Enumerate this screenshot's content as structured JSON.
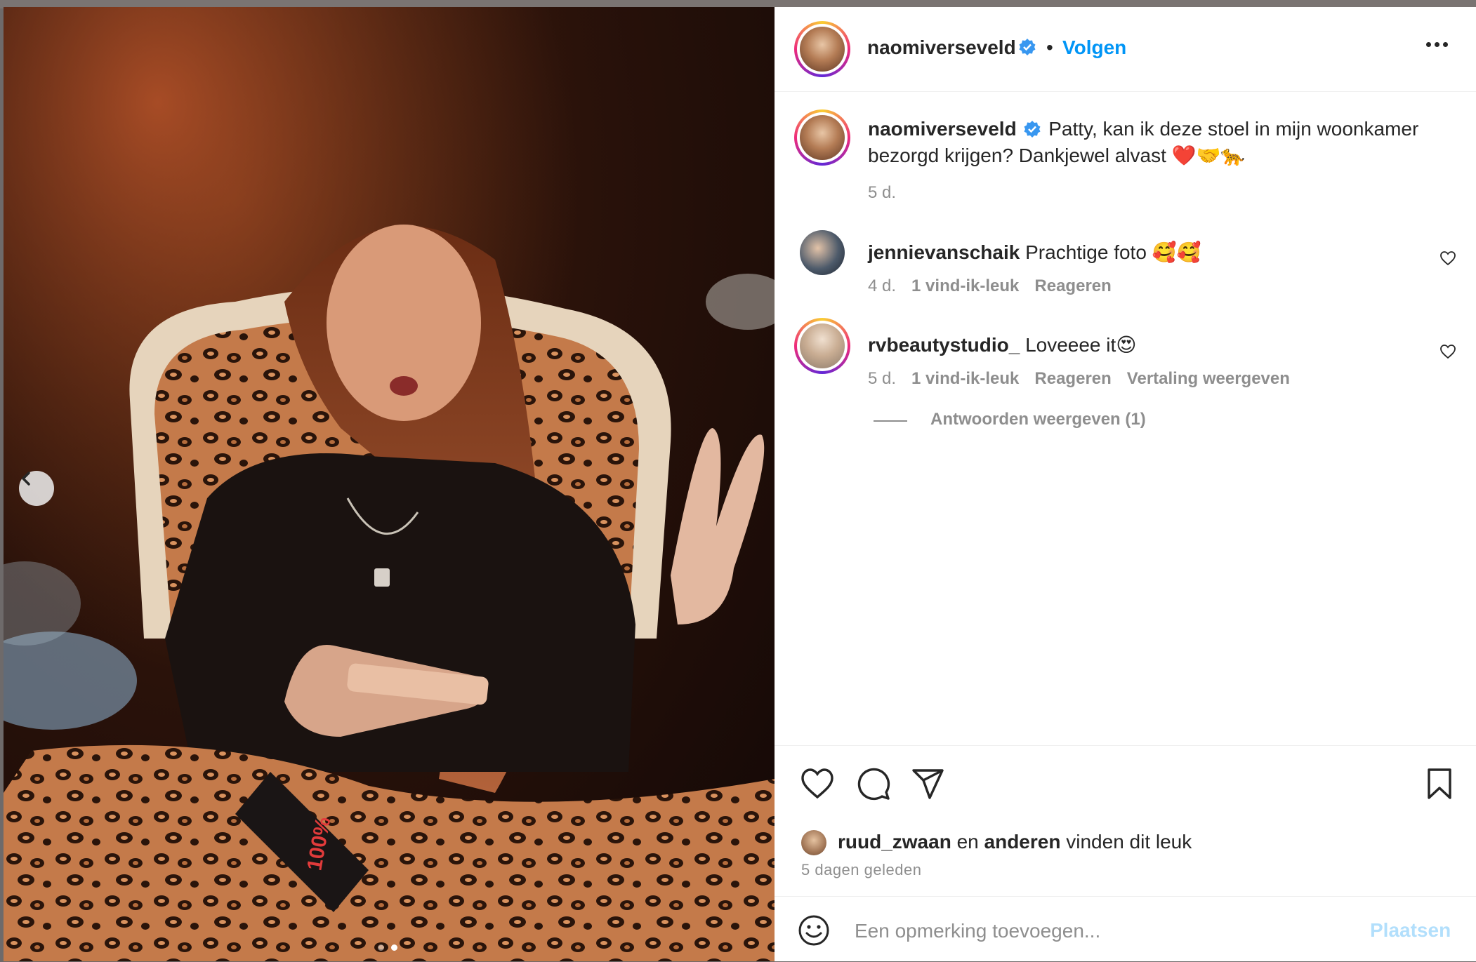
{
  "post": {
    "author": "naomiverseveld",
    "follow_label": "Volgen",
    "bullet": "•",
    "caption": "Patty, kan ik deze stoel in mijn woonkamer bezorgd krijgen? Dankjewel alvast ❤️🤝🐆",
    "caption_age": "5 d."
  },
  "comments": [
    {
      "user": "jennievanschaik",
      "text": "Prachtige foto 🥰🥰",
      "age": "4 d.",
      "likes": "1 vind-ik-leuk",
      "reply": "Reageren"
    },
    {
      "user": "rvbeautystudio_",
      "text": "Loveeee it😍",
      "age": "5 d.",
      "likes": "1 vind-ik-leuk",
      "reply": "Reageren",
      "translate": "Vertaling weergeven"
    }
  ],
  "view_replies": "Antwoorden weergeven (1)",
  "likes_summary": {
    "user": "ruud_zwaan",
    "connector": "en",
    "others": "anderen",
    "suffix": "vinden dit leuk"
  },
  "time_ago": "5 dagen geleden",
  "comment_box": {
    "placeholder": "Een opmerking toevoegen...",
    "post_label": "Plaatsen"
  },
  "colors": {
    "accent": "#0095f6",
    "verified": "#3897f0",
    "muted": "#8e8e8e",
    "text": "#262626"
  },
  "icons": [
    "verified-badge-icon",
    "more-options-icon",
    "heart-icon",
    "comment-icon",
    "share-icon",
    "bookmark-icon",
    "emoji-icon",
    "chevron-left-icon"
  ],
  "carousel": {
    "slides": 2,
    "active_slide": 2
  }
}
